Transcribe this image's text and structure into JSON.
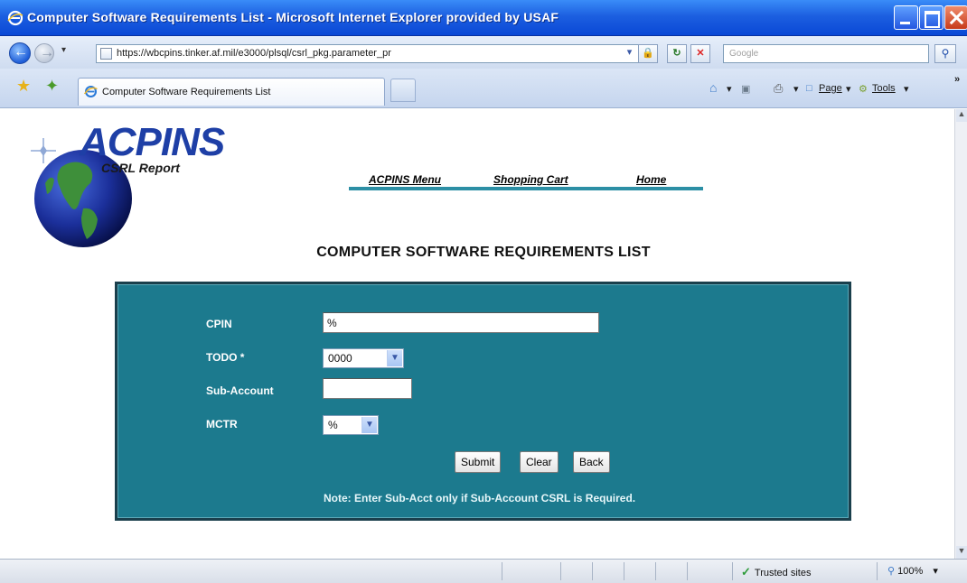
{
  "window": {
    "title": "Computer Software Requirements List - Microsoft Internet Explorer provided by USAF"
  },
  "address_bar": {
    "url": "https://wbcpins.tinker.af.mil/e3000/plsql/csrl_pkg.parameter_pr",
    "search_placeholder": "Google"
  },
  "tabs": [
    {
      "label": "Computer Software Requirements List"
    }
  ],
  "command_bar": {
    "home": "▾",
    "page": "Page",
    "tools": "Tools"
  },
  "logo": {
    "title": "ACPINS",
    "subtitle": "CSRL Report"
  },
  "nav": {
    "menu": "ACPINS Menu",
    "cart": "Shopping Cart",
    "home": "Home"
  },
  "heading": "COMPUTER SOFTWARE REQUIREMENTS LIST",
  "form": {
    "cpin_label": "CPIN",
    "cpin_value": "%",
    "todo_label": "TODO *",
    "todo_value": "0000",
    "subaccount_label": "Sub-Account",
    "subaccount_value": "",
    "mctr_label": "MCTR",
    "mctr_value": "%",
    "submit": "Submit",
    "clear": "Clear",
    "back": "Back",
    "note": "Note: Enter Sub-Acct only if Sub-Account CSRL is Required."
  },
  "status_bar": {
    "zone": "Trusted sites",
    "zoom": "100%"
  },
  "colors": {
    "panel": "#1c7a8e",
    "nav_underline": "#2c8fa5",
    "titlebar": "#1c5fe0"
  }
}
